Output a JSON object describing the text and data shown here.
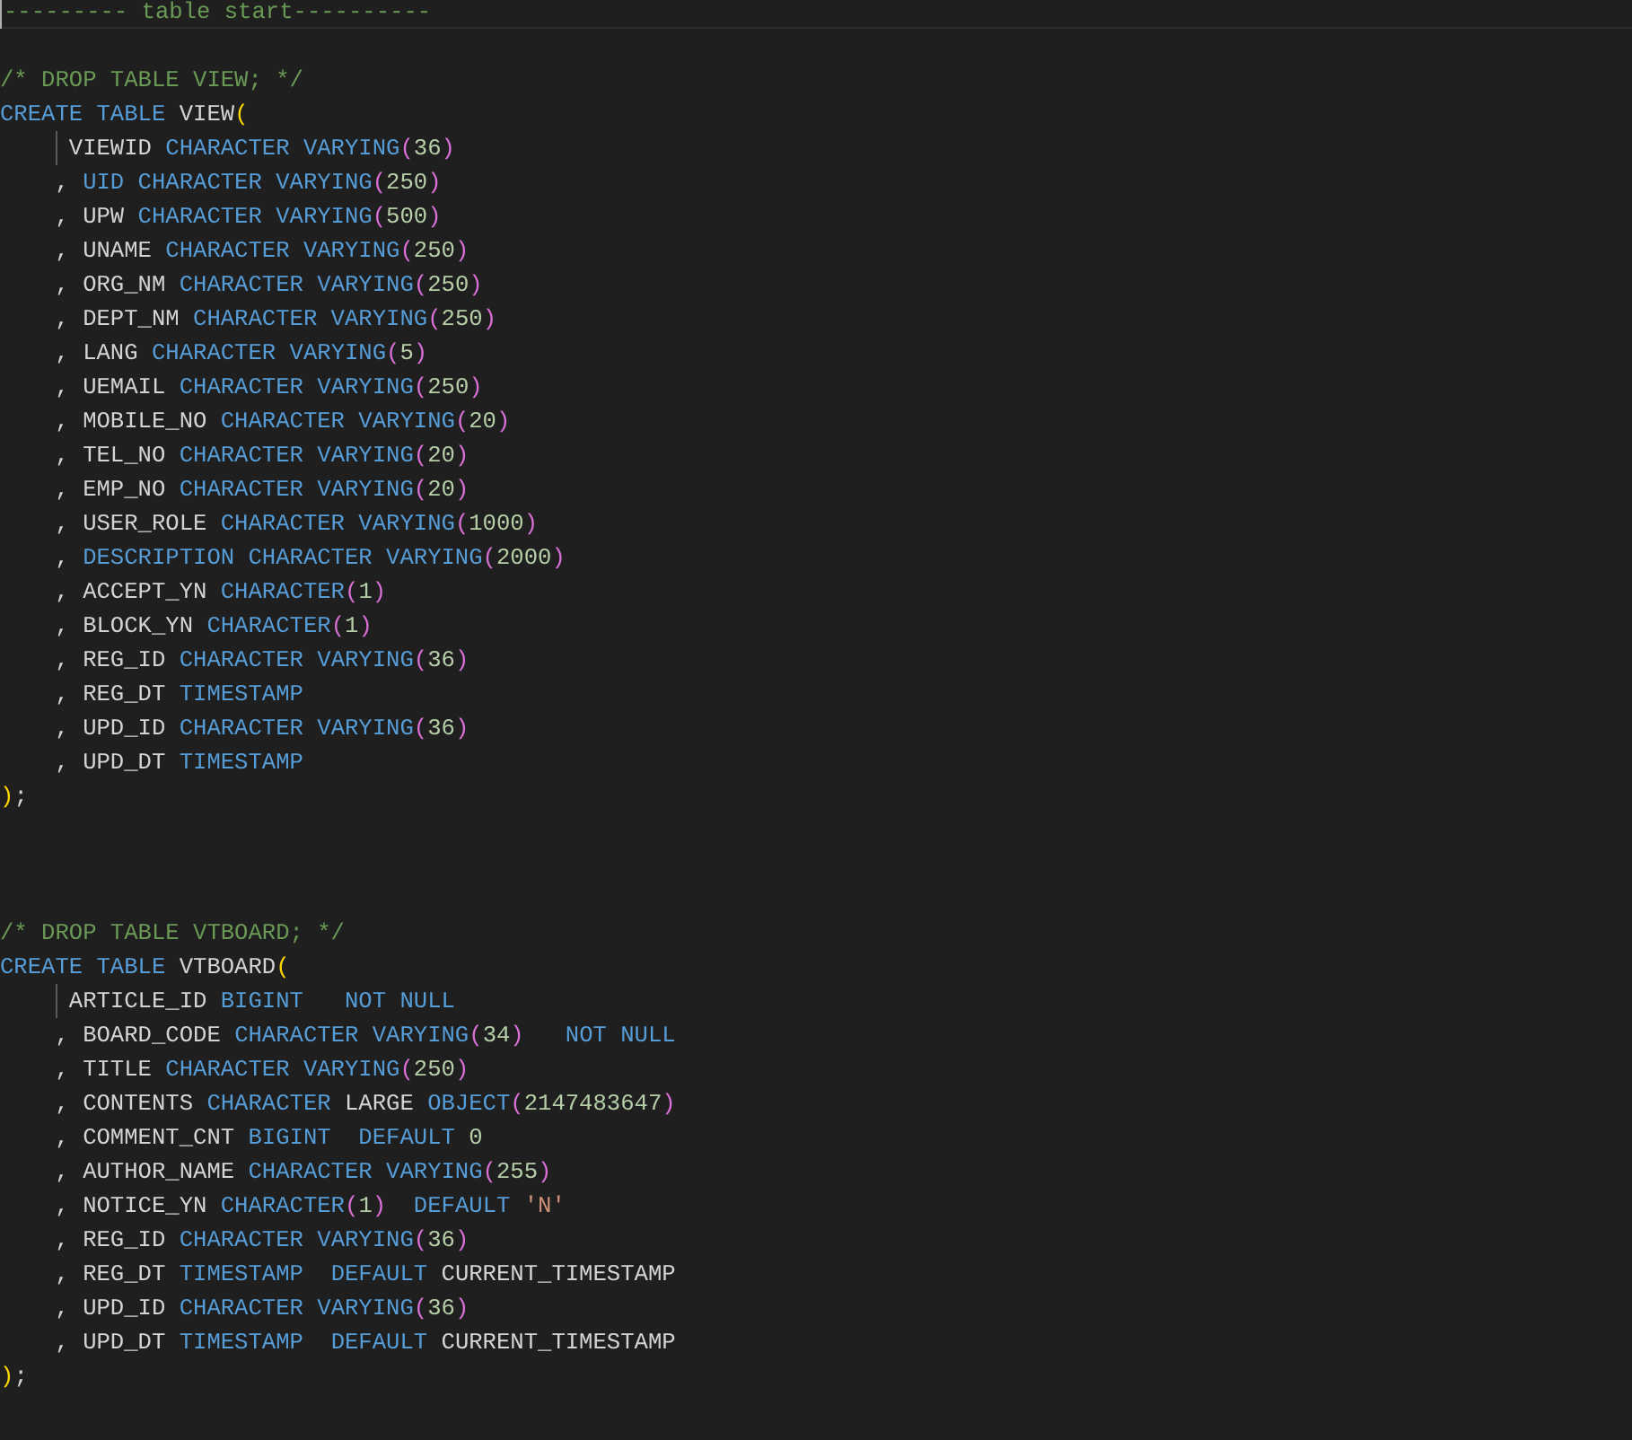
{
  "editor": {
    "lines": [
      {
        "kind": "current",
        "tokens": [
          {
            "text": "--------- table start----------",
            "kind": "comment"
          }
        ]
      },
      {
        "kind": "blank"
      },
      {
        "kind": "code",
        "tokens": [
          {
            "text": "/* DROP TABLE VIEW; */",
            "kind": "comment"
          }
        ]
      },
      {
        "kind": "code",
        "tokens": [
          {
            "text": "CREATE TABLE ",
            "kind": "keyword"
          },
          {
            "text": "VIEW",
            "kind": "name"
          },
          {
            "text": "(",
            "kind": "bracket"
          }
        ]
      },
      {
        "kind": "guide",
        "tokens": [
          {
            "text": "VIEWID ",
            "kind": "name"
          },
          {
            "text": "CHARACTER VARYING",
            "kind": "keyword"
          },
          {
            "text": "(",
            "kind": "inner_bracket"
          },
          {
            "text": "36",
            "kind": "number"
          },
          {
            "text": ")",
            "kind": "inner_bracket"
          }
        ]
      },
      {
        "kind": "code",
        "tokens": [
          {
            "text": "    , ",
            "kind": "punct"
          },
          {
            "text": "UID ",
            "kind": "keyword"
          },
          {
            "text": "CHARACTER VARYING",
            "kind": "keyword"
          },
          {
            "text": "(",
            "kind": "inner_bracket"
          },
          {
            "text": "250",
            "kind": "number"
          },
          {
            "text": ")",
            "kind": "inner_bracket"
          }
        ]
      },
      {
        "kind": "code",
        "tokens": [
          {
            "text": "    , ",
            "kind": "punct"
          },
          {
            "text": "UPW ",
            "kind": "name"
          },
          {
            "text": "CHARACTER VARYING",
            "kind": "keyword"
          },
          {
            "text": "(",
            "kind": "inner_bracket"
          },
          {
            "text": "500",
            "kind": "number"
          },
          {
            "text": ")",
            "kind": "inner_bracket"
          }
        ]
      },
      {
        "kind": "code",
        "tokens": [
          {
            "text": "    , ",
            "kind": "punct"
          },
          {
            "text": "UNAME ",
            "kind": "name"
          },
          {
            "text": "CHARACTER VARYING",
            "kind": "keyword"
          },
          {
            "text": "(",
            "kind": "inner_bracket"
          },
          {
            "text": "250",
            "kind": "number"
          },
          {
            "text": ")",
            "kind": "inner_bracket"
          }
        ]
      },
      {
        "kind": "code",
        "tokens": [
          {
            "text": "    , ",
            "kind": "punct"
          },
          {
            "text": "ORG_NM ",
            "kind": "name"
          },
          {
            "text": "CHARACTER VARYING",
            "kind": "keyword"
          },
          {
            "text": "(",
            "kind": "inner_bracket"
          },
          {
            "text": "250",
            "kind": "number"
          },
          {
            "text": ")",
            "kind": "inner_bracket"
          }
        ]
      },
      {
        "kind": "code",
        "tokens": [
          {
            "text": "    , ",
            "kind": "punct"
          },
          {
            "text": "DEPT_NM ",
            "kind": "name"
          },
          {
            "text": "CHARACTER VARYING",
            "kind": "keyword"
          },
          {
            "text": "(",
            "kind": "inner_bracket"
          },
          {
            "text": "250",
            "kind": "number"
          },
          {
            "text": ")",
            "kind": "inner_bracket"
          }
        ]
      },
      {
        "kind": "code",
        "tokens": [
          {
            "text": "    , ",
            "kind": "punct"
          },
          {
            "text": "LANG ",
            "kind": "name"
          },
          {
            "text": "CHARACTER VARYING",
            "kind": "keyword"
          },
          {
            "text": "(",
            "kind": "inner_bracket"
          },
          {
            "text": "5",
            "kind": "number"
          },
          {
            "text": ")",
            "kind": "inner_bracket"
          }
        ]
      },
      {
        "kind": "code",
        "tokens": [
          {
            "text": "    , ",
            "kind": "punct"
          },
          {
            "text": "UEMAIL ",
            "kind": "name"
          },
          {
            "text": "CHARACTER VARYING",
            "kind": "keyword"
          },
          {
            "text": "(",
            "kind": "inner_bracket"
          },
          {
            "text": "250",
            "kind": "number"
          },
          {
            "text": ")",
            "kind": "inner_bracket"
          }
        ]
      },
      {
        "kind": "code",
        "tokens": [
          {
            "text": "    , ",
            "kind": "punct"
          },
          {
            "text": "MOBILE_NO ",
            "kind": "name"
          },
          {
            "text": "CHARACTER VARYING",
            "kind": "keyword"
          },
          {
            "text": "(",
            "kind": "inner_bracket"
          },
          {
            "text": "20",
            "kind": "number"
          },
          {
            "text": ")",
            "kind": "inner_bracket"
          }
        ]
      },
      {
        "kind": "code",
        "tokens": [
          {
            "text": "    , ",
            "kind": "punct"
          },
          {
            "text": "TEL_NO ",
            "kind": "name"
          },
          {
            "text": "CHARACTER VARYING",
            "kind": "keyword"
          },
          {
            "text": "(",
            "kind": "inner_bracket"
          },
          {
            "text": "20",
            "kind": "number"
          },
          {
            "text": ")",
            "kind": "inner_bracket"
          }
        ]
      },
      {
        "kind": "code",
        "tokens": [
          {
            "text": "    , ",
            "kind": "punct"
          },
          {
            "text": "EMP_NO ",
            "kind": "name"
          },
          {
            "text": "CHARACTER VARYING",
            "kind": "keyword"
          },
          {
            "text": "(",
            "kind": "inner_bracket"
          },
          {
            "text": "20",
            "kind": "number"
          },
          {
            "text": ")",
            "kind": "inner_bracket"
          }
        ]
      },
      {
        "kind": "code",
        "tokens": [
          {
            "text": "    , ",
            "kind": "punct"
          },
          {
            "text": "USER_ROLE ",
            "kind": "name"
          },
          {
            "text": "CHARACTER VARYING",
            "kind": "keyword"
          },
          {
            "text": "(",
            "kind": "inner_bracket"
          },
          {
            "text": "1000",
            "kind": "number"
          },
          {
            "text": ")",
            "kind": "inner_bracket"
          }
        ]
      },
      {
        "kind": "code",
        "tokens": [
          {
            "text": "    , ",
            "kind": "punct"
          },
          {
            "text": "DESCRIPTION ",
            "kind": "keyword"
          },
          {
            "text": "CHARACTER VARYING",
            "kind": "keyword"
          },
          {
            "text": "(",
            "kind": "inner_bracket"
          },
          {
            "text": "2000",
            "kind": "number"
          },
          {
            "text": ")",
            "kind": "inner_bracket"
          }
        ]
      },
      {
        "kind": "code",
        "tokens": [
          {
            "text": "    , ",
            "kind": "punct"
          },
          {
            "text": "ACCEPT_YN ",
            "kind": "name"
          },
          {
            "text": "CHARACTER",
            "kind": "keyword"
          },
          {
            "text": "(",
            "kind": "inner_bracket"
          },
          {
            "text": "1",
            "kind": "number"
          },
          {
            "text": ")",
            "kind": "inner_bracket"
          }
        ]
      },
      {
        "kind": "code",
        "tokens": [
          {
            "text": "    , ",
            "kind": "punct"
          },
          {
            "text": "BLOCK_YN ",
            "kind": "name"
          },
          {
            "text": "CHARACTER",
            "kind": "keyword"
          },
          {
            "text": "(",
            "kind": "inner_bracket"
          },
          {
            "text": "1",
            "kind": "number"
          },
          {
            "text": ")",
            "kind": "inner_bracket"
          }
        ]
      },
      {
        "kind": "code",
        "tokens": [
          {
            "text": "    , ",
            "kind": "punct"
          },
          {
            "text": "REG_ID ",
            "kind": "name"
          },
          {
            "text": "CHARACTER VARYING",
            "kind": "keyword"
          },
          {
            "text": "(",
            "kind": "inner_bracket"
          },
          {
            "text": "36",
            "kind": "number"
          },
          {
            "text": ")",
            "kind": "inner_bracket"
          }
        ]
      },
      {
        "kind": "code",
        "tokens": [
          {
            "text": "    , ",
            "kind": "punct"
          },
          {
            "text": "REG_DT ",
            "kind": "name"
          },
          {
            "text": "TIMESTAMP",
            "kind": "keyword"
          }
        ]
      },
      {
        "kind": "code",
        "tokens": [
          {
            "text": "    , ",
            "kind": "punct"
          },
          {
            "text": "UPD_ID ",
            "kind": "name"
          },
          {
            "text": "CHARACTER VARYING",
            "kind": "keyword"
          },
          {
            "text": "(",
            "kind": "inner_bracket"
          },
          {
            "text": "36",
            "kind": "number"
          },
          {
            "text": ")",
            "kind": "inner_bracket"
          }
        ]
      },
      {
        "kind": "code",
        "tokens": [
          {
            "text": "    , ",
            "kind": "punct"
          },
          {
            "text": "UPD_DT ",
            "kind": "name"
          },
          {
            "text": "TIMESTAMP",
            "kind": "keyword"
          }
        ]
      },
      {
        "kind": "code",
        "tokens": [
          {
            "text": ")",
            "kind": "bracket"
          },
          {
            "text": ";",
            "kind": "punct"
          }
        ]
      },
      {
        "kind": "blank"
      },
      {
        "kind": "blank"
      },
      {
        "kind": "blank"
      },
      {
        "kind": "code",
        "tokens": [
          {
            "text": "/* DROP TABLE VTBOARD; */",
            "kind": "comment"
          }
        ]
      },
      {
        "kind": "code",
        "tokens": [
          {
            "text": "CREATE TABLE ",
            "kind": "keyword"
          },
          {
            "text": "VTBOARD",
            "kind": "name"
          },
          {
            "text": "(",
            "kind": "bracket"
          }
        ]
      },
      {
        "kind": "guide",
        "tokens": [
          {
            "text": "ARTICLE_ID ",
            "kind": "name"
          },
          {
            "text": "BIGINT   NOT NULL",
            "kind": "keyword"
          }
        ]
      },
      {
        "kind": "code",
        "tokens": [
          {
            "text": "    , ",
            "kind": "punct"
          },
          {
            "text": "BOARD_CODE ",
            "kind": "name"
          },
          {
            "text": "CHARACTER VARYING",
            "kind": "keyword"
          },
          {
            "text": "(",
            "kind": "inner_bracket"
          },
          {
            "text": "34",
            "kind": "number"
          },
          {
            "text": ")",
            "kind": "inner_bracket"
          },
          {
            "text": "   NOT NULL",
            "kind": "keyword"
          }
        ]
      },
      {
        "kind": "code",
        "tokens": [
          {
            "text": "    , ",
            "kind": "punct"
          },
          {
            "text": "TITLE ",
            "kind": "name"
          },
          {
            "text": "CHARACTER VARYING",
            "kind": "keyword"
          },
          {
            "text": "(",
            "kind": "inner_bracket"
          },
          {
            "text": "250",
            "kind": "number"
          },
          {
            "text": ")",
            "kind": "inner_bracket"
          }
        ]
      },
      {
        "kind": "code",
        "tokens": [
          {
            "text": "    , ",
            "kind": "punct"
          },
          {
            "text": "CONTENTS ",
            "kind": "name"
          },
          {
            "text": "CHARACTER ",
            "kind": "keyword"
          },
          {
            "text": "LARGE ",
            "kind": "name"
          },
          {
            "text": "OBJECT",
            "kind": "keyword"
          },
          {
            "text": "(",
            "kind": "inner_bracket"
          },
          {
            "text": "2147483647",
            "kind": "number"
          },
          {
            "text": ")",
            "kind": "inner_bracket"
          }
        ]
      },
      {
        "kind": "code",
        "tokens": [
          {
            "text": "    , ",
            "kind": "punct"
          },
          {
            "text": "COMMENT_CNT ",
            "kind": "name"
          },
          {
            "text": "BIGINT  DEFAULT ",
            "kind": "keyword"
          },
          {
            "text": "0",
            "kind": "number"
          }
        ]
      },
      {
        "kind": "code",
        "tokens": [
          {
            "text": "    , ",
            "kind": "punct"
          },
          {
            "text": "AUTHOR_NAME ",
            "kind": "name"
          },
          {
            "text": "CHARACTER VARYING",
            "kind": "keyword"
          },
          {
            "text": "(",
            "kind": "inner_bracket"
          },
          {
            "text": "255",
            "kind": "number"
          },
          {
            "text": ")",
            "kind": "inner_bracket"
          }
        ]
      },
      {
        "kind": "code",
        "tokens": [
          {
            "text": "    , ",
            "kind": "punct"
          },
          {
            "text": "NOTICE_YN ",
            "kind": "name"
          },
          {
            "text": "CHARACTER",
            "kind": "keyword"
          },
          {
            "text": "(",
            "kind": "inner_bracket"
          },
          {
            "text": "1",
            "kind": "number"
          },
          {
            "text": ")",
            "kind": "inner_bracket"
          },
          {
            "text": "  DEFAULT ",
            "kind": "keyword"
          },
          {
            "text": "'N'",
            "kind": "string"
          }
        ]
      },
      {
        "kind": "code",
        "tokens": [
          {
            "text": "    , ",
            "kind": "punct"
          },
          {
            "text": "REG_ID ",
            "kind": "name"
          },
          {
            "text": "CHARACTER VARYING",
            "kind": "keyword"
          },
          {
            "text": "(",
            "kind": "inner_bracket"
          },
          {
            "text": "36",
            "kind": "number"
          },
          {
            "text": ")",
            "kind": "inner_bracket"
          }
        ]
      },
      {
        "kind": "code",
        "tokens": [
          {
            "text": "    , ",
            "kind": "punct"
          },
          {
            "text": "REG_DT ",
            "kind": "name"
          },
          {
            "text": "TIMESTAMP  DEFAULT ",
            "kind": "keyword"
          },
          {
            "text": "CURRENT_TIMESTAMP",
            "kind": "name"
          }
        ]
      },
      {
        "kind": "code",
        "tokens": [
          {
            "text": "    , ",
            "kind": "punct"
          },
          {
            "text": "UPD_ID ",
            "kind": "name"
          },
          {
            "text": "CHARACTER VARYING",
            "kind": "keyword"
          },
          {
            "text": "(",
            "kind": "inner_bracket"
          },
          {
            "text": "36",
            "kind": "number"
          },
          {
            "text": ")",
            "kind": "inner_bracket"
          }
        ]
      },
      {
        "kind": "code",
        "tokens": [
          {
            "text": "    , ",
            "kind": "punct"
          },
          {
            "text": "UPD_DT ",
            "kind": "name"
          },
          {
            "text": "TIMESTAMP  DEFAULT ",
            "kind": "keyword"
          },
          {
            "text": "CURRENT_TIMESTAMP",
            "kind": "name"
          }
        ]
      },
      {
        "kind": "code",
        "tokens": [
          {
            "text": ")",
            "kind": "bracket"
          },
          {
            "text": ";",
            "kind": "punct"
          }
        ]
      }
    ]
  }
}
